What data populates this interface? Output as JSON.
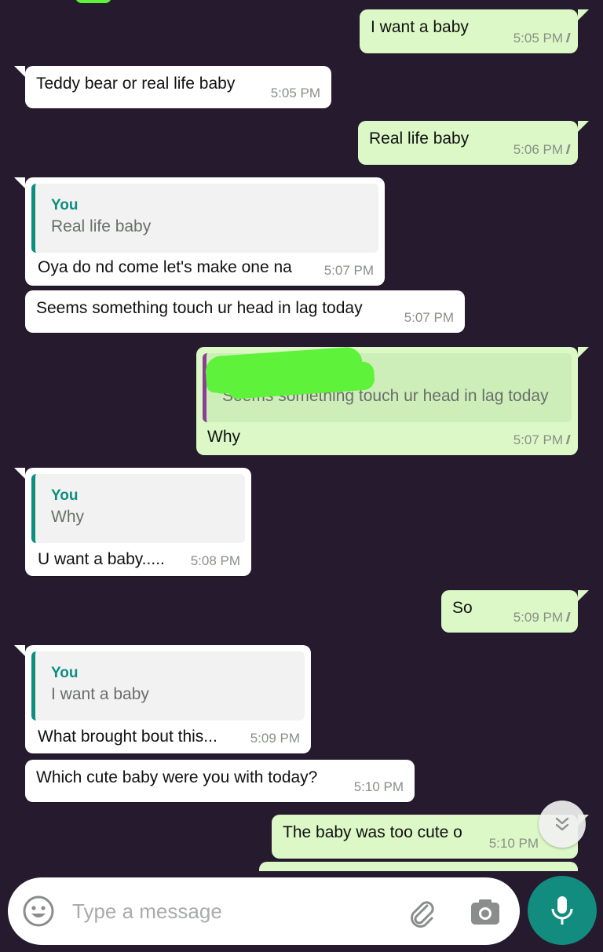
{
  "messages": [
    {
      "text": "I want a baby",
      "time": "5:05 PM"
    },
    {
      "text": "Teddy bear or real life baby",
      "time": "5:05 PM"
    },
    {
      "text": "Real life baby",
      "time": "5:06 PM"
    },
    {
      "quote_author": "You",
      "quote_text": "Real life baby",
      "text": "Oya do nd come let's make one na",
      "time": "5:07 PM"
    },
    {
      "text": "Seems something touch ur head in lag today",
      "time": "5:07 PM"
    },
    {
      "quote_text": "Seems something touch ur head in lag today",
      "text": "Why",
      "time": "5:07 PM"
    },
    {
      "quote_author": "You",
      "quote_text": "Why",
      "text": "U want a baby.....",
      "time": "5:08 PM"
    },
    {
      "text": "So",
      "time": "5:09 PM"
    },
    {
      "quote_author": "You",
      "quote_text": "I want a baby",
      "text": "What brought bout this...",
      "time": "5:09 PM"
    },
    {
      "text": "Which cute baby were you with today?",
      "time": "5:10 PM"
    },
    {
      "text": "The baby was too cute o",
      "time": "5:10 PM"
    }
  ],
  "ticks": "//",
  "composer": {
    "placeholder": "Type a message"
  },
  "colors": {
    "background": "#261b2e",
    "outgoing_bubble": "#dcf8c6",
    "incoming_bubble": "#ffffff",
    "accent": "#128c7e",
    "quote_author": "#0d8f80",
    "redaction": "#5ef23a"
  },
  "icons": [
    "emoji-icon",
    "attach-icon",
    "camera-icon",
    "mic-icon",
    "scroll-down-icon",
    "double-check-icon"
  ]
}
